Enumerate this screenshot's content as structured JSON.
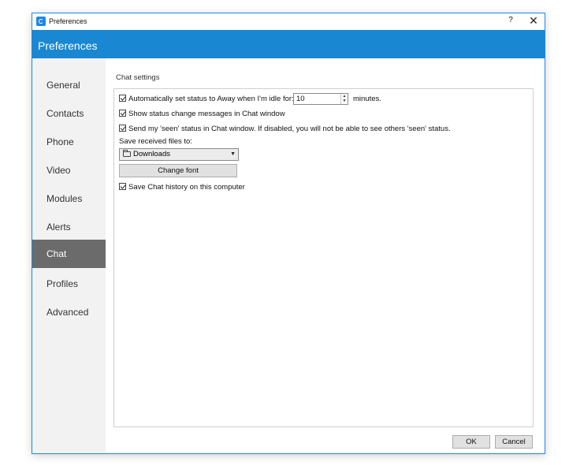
{
  "window": {
    "title": "Preferences",
    "help": "?",
    "close": "✕"
  },
  "header": {
    "title": "Preferences"
  },
  "sidebar": {
    "items": [
      {
        "label": "General"
      },
      {
        "label": "Contacts"
      },
      {
        "label": "Phone"
      },
      {
        "label": "Video"
      },
      {
        "label": "Modules"
      },
      {
        "label": "Alerts"
      },
      {
        "label": "Chat",
        "active": true
      },
      {
        "label": "Profiles"
      },
      {
        "label": "Advanced"
      }
    ]
  },
  "chat": {
    "section_title": "Chat settings",
    "away": {
      "checked": true,
      "label": "Automatically set status to Away when I'm idle for:",
      "value": "10",
      "unit": "minutes."
    },
    "status_messages": {
      "checked": true,
      "label": "Show status change messages in Chat window"
    },
    "seen_status": {
      "checked": true,
      "label": "Send my 'seen' status in Chat window. If disabled, you will not be able to see others 'seen' status."
    },
    "save_files_label": "Save received files to:",
    "save_folder": "Downloads",
    "change_font": "Change font",
    "save_history": {
      "checked": true,
      "label": "Save Chat history on this computer"
    }
  },
  "footer": {
    "ok": "OK",
    "cancel": "Cancel"
  },
  "colors": {
    "header_bg": "#1a87d2",
    "active_nav_bg": "#6b6b6b",
    "sidebar_bg": "#f2f2f2",
    "window_border": "#1e88e5"
  }
}
